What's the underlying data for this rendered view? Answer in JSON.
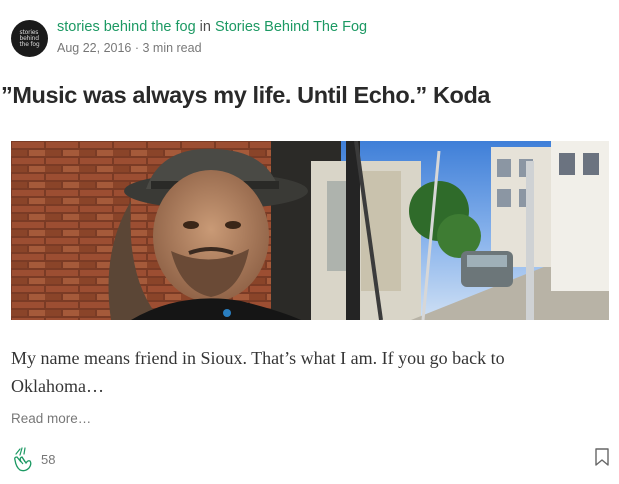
{
  "author": {
    "avatar_text": "stories\nbehind\nthe fog",
    "name": "stories behind the fog",
    "in_word": " in ",
    "publication": "Stories Behind The Fog"
  },
  "post": {
    "date": "Aug 22, 2016",
    "separator": " · ",
    "read_time": "3 min read",
    "title": "”Music was always my life. Until Echo.” Koda",
    "excerpt": "My name means friend in Sioux. That’s what I am. If you go back to Oklahoma…",
    "read_more": "Read more…"
  },
  "footer": {
    "clap_count": "58",
    "clap_icon": "clap-icon",
    "bookmark_icon": "bookmark-icon"
  },
  "colors": {
    "accent": "#1c9963",
    "clap_icon": "#1c9963"
  }
}
